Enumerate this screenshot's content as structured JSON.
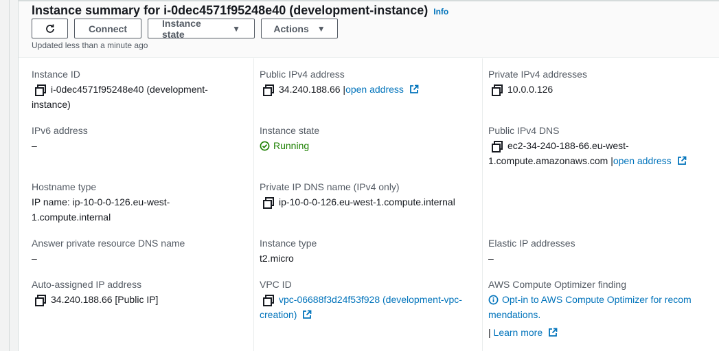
{
  "header": {
    "title": "Instance summary for i-0dec4571f95248e40 (development-instance)",
    "info": "Info",
    "buttons": {
      "connect": "Connect",
      "instance_state": "Instance state",
      "actions": "Actions"
    },
    "updated": "Updated less than a minute ago"
  },
  "fields": {
    "instance_id": {
      "label": "Instance ID",
      "value_line1": "i-0dec4571f95248e40 (development-",
      "value_line2": "instance)"
    },
    "public_ipv4": {
      "label": "Public IPv4 address",
      "value": "34.240.188.66",
      "sep": "|",
      "link": "open address"
    },
    "private_ipv4": {
      "label": "Private IPv4 addresses",
      "value": "10.0.0.126"
    },
    "ipv6": {
      "label": "IPv6 address",
      "value": "–"
    },
    "instance_state": {
      "label": "Instance state",
      "value": "Running"
    },
    "public_dns": {
      "label": "Public IPv4 DNS",
      "value_line1": "ec2-34-240-188-66.eu-west-",
      "value_line2": "1.compute.amazonaws.com",
      "sep": "|",
      "link": "open address"
    },
    "hostname_type": {
      "label": "Hostname type",
      "value_line1": "IP name: ip-10-0-0-126.eu-west-",
      "value_line2": "1.compute.internal"
    },
    "private_dns": {
      "label": "Private IP DNS name (IPv4 only)",
      "value": "ip-10-0-0-126.eu-west-1.compute.internal"
    },
    "answer_dns": {
      "label": "Answer private resource DNS name",
      "value": "–"
    },
    "instance_type": {
      "label": "Instance type",
      "value": "t2.micro"
    },
    "elastic_ip": {
      "label": "Elastic IP addresses",
      "value": "–"
    },
    "auto_ip": {
      "label": "Auto-assigned IP address",
      "value": "34.240.188.66 [Public IP]"
    },
    "vpc_id": {
      "label": "VPC ID",
      "value_line1": "vpc-06688f3d24f53f928 (development-vpc-",
      "value_line2": "creation)"
    },
    "optimizer": {
      "label": "AWS Compute Optimizer finding",
      "value_line1": "Opt-in to AWS Compute Optimizer for recom",
      "value_line2": "mendations.",
      "sep": "|",
      "link": "Learn more"
    }
  },
  "colors": {
    "link": "#0073bb",
    "running": "#1d8102",
    "label": "#545b64",
    "text": "#16191f"
  }
}
